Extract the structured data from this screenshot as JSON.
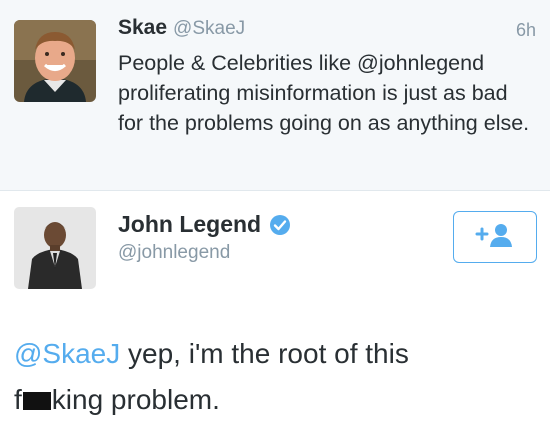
{
  "reply": {
    "display_name": "Skae",
    "handle": "@SkaeJ",
    "time": "6h",
    "text": "People & Celebrities like @johnlegend proliferating misinformation is just as bad for the problems going on as anything else."
  },
  "main": {
    "display_name": "John Legend",
    "handle": "@johnlegend",
    "verified_icon": "verified-badge-icon",
    "follow_icon": "add-user-icon",
    "mention": "@SkaeJ",
    "text_part1": " yep, i'm the root of this",
    "text_part2_prefix": "f",
    "text_part2_suffix": "king problem."
  },
  "colors": {
    "accent": "#55acee",
    "muted": "#8899a6",
    "text": "#292f33",
    "reply_bg": "#f5f8fa"
  }
}
